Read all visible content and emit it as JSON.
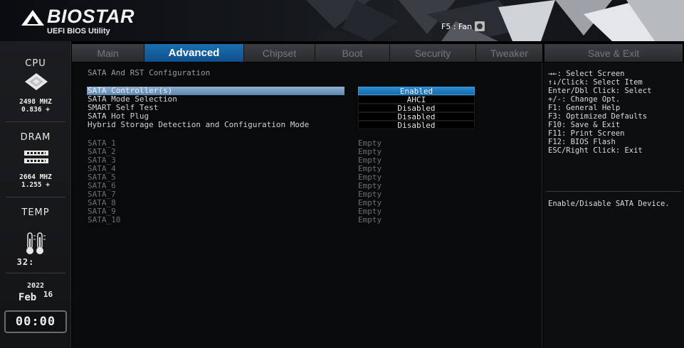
{
  "header": {
    "brand": "BIOSTAR",
    "subtitle": "UEFI BIOS Utility",
    "fan_hint": "F5 : Fan"
  },
  "sidebar": {
    "cpu_title": "CPU",
    "cpu_freq": "2498 MHZ",
    "cpu_volt": "0.836 +",
    "dram_title": "DRAM",
    "dram_freq": "2664 MHZ",
    "dram_volt": "1.255 +",
    "temp_title": "TEMP",
    "temp_value": "32:",
    "date_year": "2022",
    "date_month": "Feb",
    "date_day": "16",
    "time": "00:00"
  },
  "tabs": [
    {
      "label": "Main"
    },
    {
      "label": "Advanced"
    },
    {
      "label": "Chipset"
    },
    {
      "label": "Boot"
    },
    {
      "label": "Security"
    },
    {
      "label": "Tweaker"
    }
  ],
  "save_exit_tab": "Save & Exit",
  "main": {
    "section_title": "SATA And RST Configuration",
    "settings": [
      {
        "label": "SATA Controller(s)",
        "value": "Enabled"
      },
      {
        "label": "SATA Mode Selection",
        "value": "AHCI"
      },
      {
        "label": "SMART Self Test",
        "value": "Disabled"
      },
      {
        "label": "SATA Hot Plug",
        "value": "Disabled"
      },
      {
        "label": "Hybrid Storage Detection and Configuration Mode",
        "value": "Disabled"
      }
    ],
    "ports": [
      {
        "label": "SATA_1",
        "value": "Empty"
      },
      {
        "label": "SATA_2",
        "value": "Empty"
      },
      {
        "label": "SATA_3",
        "value": "Empty"
      },
      {
        "label": "SATA_4",
        "value": "Empty"
      },
      {
        "label": "SATA_5",
        "value": "Empty"
      },
      {
        "label": "SATA_6",
        "value": "Empty"
      },
      {
        "label": "SATA_7",
        "value": "Empty"
      },
      {
        "label": "SATA_8",
        "value": "Empty"
      },
      {
        "label": "SATA_9",
        "value": "Empty"
      },
      {
        "label": "SATA_10",
        "value": "Empty"
      }
    ]
  },
  "help": {
    "keys": [
      "→←: Select Screen",
      "↑↓/Click: Select Item",
      "Enter/Dbl Click: Select",
      "+/-: Change Opt.",
      "F1: General Help",
      "F3: Optimized Defaults",
      "F10: Save & Exit",
      "F11: Print Screen",
      "F12: BIOS Flash",
      "ESC/Right Click: Exit"
    ],
    "description": "Enable/Disable SATA Device."
  },
  "colors": {
    "active_tab": "#1a6fb0",
    "selected_value": "#2b8cd0",
    "selected_label": "#7a9dc0"
  }
}
